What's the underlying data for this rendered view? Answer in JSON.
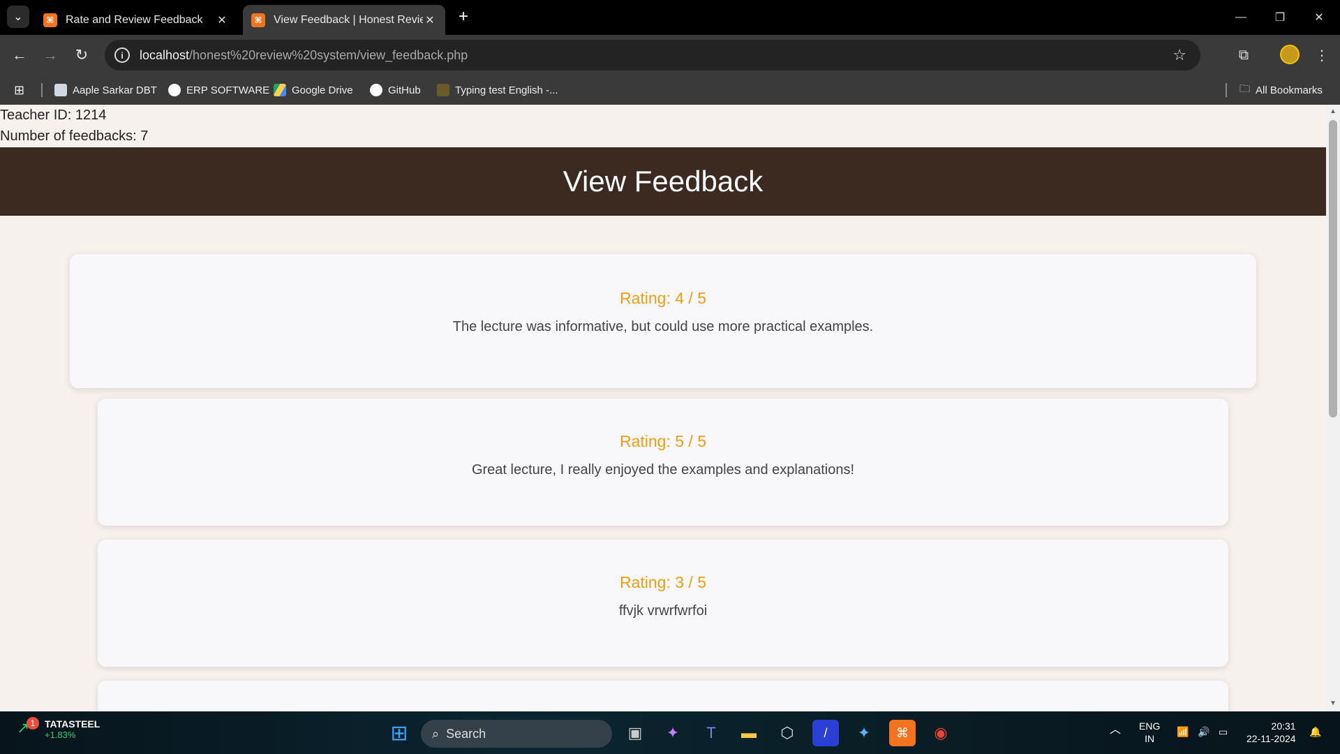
{
  "browser": {
    "tabs": [
      {
        "label": "Rate and Review Feedback",
        "favicon": "xampp-icon"
      },
      {
        "label": "View Feedback | Honest Review",
        "favicon": "xampp-icon"
      }
    ],
    "url_host": "localhost",
    "url_path": "/honest%20review%20system/view_feedback.php",
    "bookmarks": [
      {
        "label": "Aaple Sarkar DBT"
      },
      {
        "label": "ERP SOFTWARE"
      },
      {
        "label": "Google Drive"
      },
      {
        "label": "GitHub"
      },
      {
        "label": "Typing test English -..."
      }
    ],
    "all_bookmarks_label": "All Bookmarks"
  },
  "page": {
    "teacher_id": "Teacher ID: 1214",
    "feedback_count": "Number of feedbacks: 7",
    "heading": "View Feedback",
    "feedbacks": [
      {
        "rating": "Rating: 4 / 5",
        "comment": "The lecture was informative, but could use more practical examples."
      },
      {
        "rating": "Rating: 5 / 5",
        "comment": "Great lecture, I really enjoyed the examples and explanations!"
      },
      {
        "rating": "Rating: 3 / 5",
        "comment": "ffvjk vrwrfwrfoi"
      }
    ]
  },
  "taskbar": {
    "stock_name": "TATASTEEL",
    "stock_change": "+1.83%",
    "notification_count": "1",
    "search_label": "Search",
    "lang_top": "ENG",
    "lang_bottom": "IN",
    "time": "20:31",
    "date": "22-11-2024"
  },
  "colors": {
    "header_bg": "#3c2a20",
    "rating_color": "#f39c12",
    "page_bg": "#f7f1ee"
  }
}
